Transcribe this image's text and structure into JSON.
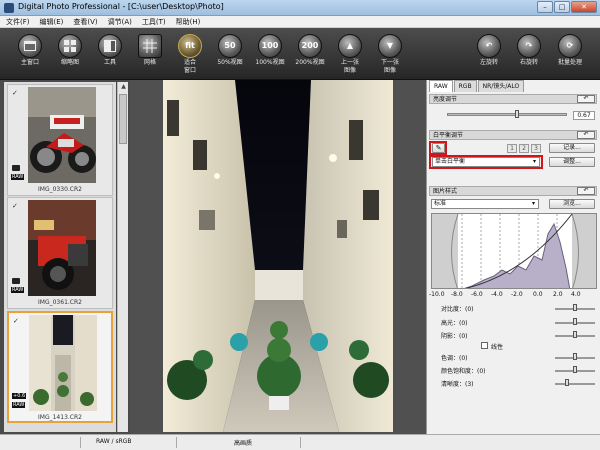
{
  "window": {
    "title": "Digital Photo Professional - [C:\\user\\Desktop\\Photo]",
    "btn_min": "–",
    "btn_max": "□",
    "btn_close": "✕"
  },
  "menu": [
    "文件(F)",
    "编辑(E)",
    "查看(V)",
    "调节(A)",
    "工具(T)",
    "帮助(H)"
  ],
  "toolbar": {
    "main": "主窗口",
    "thumb": "缩略图",
    "tool": "工具",
    "grid": "网格",
    "fit_line1": "适合",
    "fit_line2": "窗口",
    "fit_icon": "fit",
    "v50": "50%视图",
    "v50_icon": "50",
    "v100": "100%视图",
    "v100_icon": "100",
    "v200": "200%视图",
    "v200_icon": "200",
    "prev_line1": "上一张",
    "prev_line2": "图像",
    "next_line1": "下一张",
    "next_line2": "图像",
    "rotl": "左旋转",
    "rotr": "右旋转",
    "batch": "批量处理"
  },
  "thumbnails": [
    {
      "name": "IMG_0330.CR2",
      "badge": "RAW",
      "mark": "✓"
    },
    {
      "name": "IMG_0361.CR2",
      "badge": "RAW",
      "mark": "✓"
    },
    {
      "name": "IMG_1413.CR2",
      "badge": "RAW",
      "mark": "✓",
      "extra": "+0.6"
    }
  ],
  "tabs": [
    "RAW",
    "RGB",
    "NR/镜头/ALO"
  ],
  "brightness": {
    "title": "亮度调节",
    "value": "0.67"
  },
  "white_balance": {
    "title": "白平衡调节",
    "record_button": "记录...",
    "preset_buttons": [
      "1",
      "2",
      "3"
    ],
    "mode": "单击白平衡",
    "adjust_button": "调整..."
  },
  "picture_style": {
    "title": "图片样式",
    "style": "标准",
    "browse_button": "浏览...",
    "axis_ticks": [
      "-10.0",
      "-8.0",
      "-6.0",
      "-4.0",
      "-2.0",
      "0.0",
      "2.0",
      "4.0"
    ],
    "params": [
      {
        "label": "对比度：(0)"
      },
      {
        "label": "高光：(0)"
      },
      {
        "label": "阴影：(0)"
      },
      {
        "label": "色调：(0)"
      },
      {
        "label": "颜色饱和度：(0)"
      },
      {
        "label": "清晰度：(3)"
      }
    ],
    "linear_label": "线性"
  },
  "status": {
    "left": "RAW / sRGB",
    "right": "高画质"
  },
  "icons": {
    "up": "▲",
    "down": "▼",
    "rotl": "↶",
    "rotr": "↷",
    "batch": "⟳",
    "caret": "▾",
    "reset": "↶",
    "eyedrop": "✎",
    "slider_thumb": "▲"
  }
}
